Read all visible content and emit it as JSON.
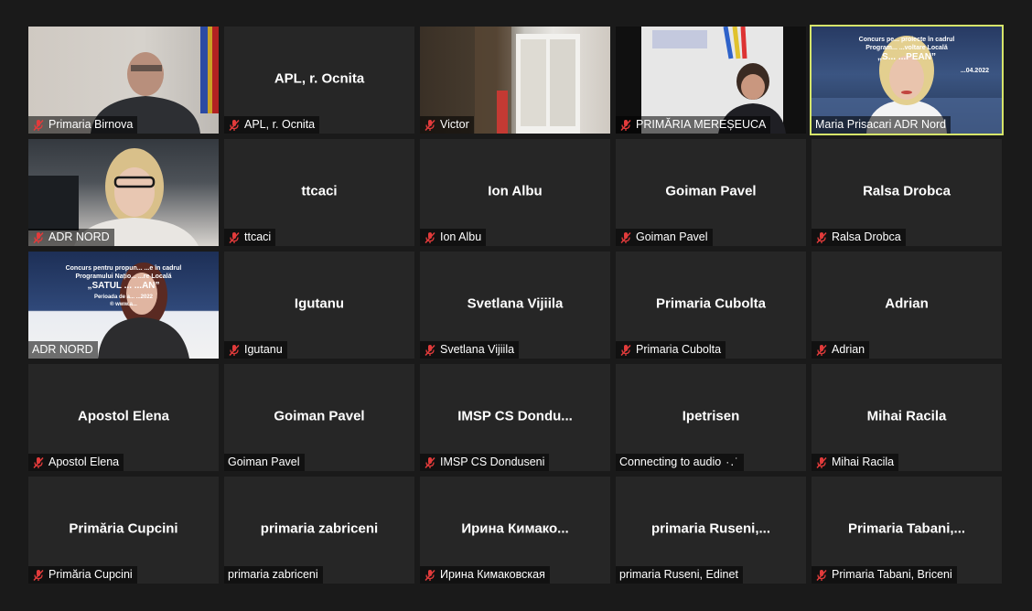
{
  "meeting": {
    "accent_color": "#d6e56a",
    "muted_icon": "mic-muted-icon",
    "tiles": [
      {
        "label": "Primaria Birnova",
        "display_name": "",
        "muted": true,
        "video": "v1"
      },
      {
        "label": "APL, r. Ocnita",
        "display_name": "APL, r. Ocnita",
        "muted": true,
        "video": ""
      },
      {
        "label": "Victor",
        "display_name": "",
        "muted": true,
        "video": "v2"
      },
      {
        "label": "PRIMĂRIA MEREȘEUCA",
        "display_name": "",
        "muted": true,
        "video": "v3"
      },
      {
        "label": "Maria Prisacari ADR Nord",
        "display_name": "",
        "muted": false,
        "video": "v4",
        "active": true
      },
      {
        "label": "ADR NORD",
        "display_name": "",
        "muted": true,
        "video": "v5"
      },
      {
        "label": "ttcaci",
        "display_name": "ttcaci",
        "muted": true,
        "video": ""
      },
      {
        "label": "Ion Albu",
        "display_name": "Ion Albu",
        "muted": true,
        "video": ""
      },
      {
        "label": "Goiman Pavel",
        "display_name": "Goiman Pavel",
        "muted": true,
        "video": ""
      },
      {
        "label": "Ralsa Drobca",
        "display_name": "Ralsa Drobca",
        "muted": true,
        "video": ""
      },
      {
        "label": "ADR NORD",
        "display_name": "",
        "muted": false,
        "video": "v6"
      },
      {
        "label": "Igutanu",
        "display_name": "Igutanu",
        "muted": true,
        "video": ""
      },
      {
        "label": "Svetlana Vijiila",
        "display_name": "Svetlana Vijiila",
        "muted": true,
        "video": ""
      },
      {
        "label": "Primaria Cubolta",
        "display_name": "Primaria Cubolta",
        "muted": true,
        "video": ""
      },
      {
        "label": "Adrian",
        "display_name": "Adrian",
        "muted": true,
        "video": ""
      },
      {
        "label": "Apostol Elena",
        "display_name": "Apostol Elena",
        "muted": true,
        "video": ""
      },
      {
        "label": "Goiman Pavel",
        "display_name": "Goiman Pavel",
        "muted": false,
        "video": ""
      },
      {
        "label": "IMSP CS Donduseni",
        "display_name": "IMSP  CS  Dondu...",
        "muted": true,
        "video": ""
      },
      {
        "label": "Connecting to audio",
        "display_name": "Ipetrisen",
        "muted": false,
        "connecting": true,
        "video": ""
      },
      {
        "label": "Mihai Racila",
        "display_name": "Mihai Racila",
        "muted": true,
        "video": ""
      },
      {
        "label": "Primăria Cupcini",
        "display_name": "Primăria Cupcini",
        "muted": true,
        "video": ""
      },
      {
        "label": "primaria zabriceni",
        "display_name": "primaria zabriceni",
        "muted": false,
        "video": ""
      },
      {
        "label": "Ирина Кимаковская",
        "display_name": "Ирина  Кимако...",
        "muted": true,
        "video": ""
      },
      {
        "label": "primaria Ruseni, Edinet",
        "display_name": "primaria  Ruseni,...",
        "muted": false,
        "video": ""
      },
      {
        "label": "Primaria Tabani, Briceni",
        "display_name": "Primaria  Tabani,...",
        "muted": true,
        "video": ""
      }
    ]
  },
  "posters": {
    "top": {
      "line1": "Concurs pe... proiecte în cadrul",
      "line2": "Program... ...voltare Locală",
      "line3": "„S... ...PEAN”",
      "line4": "...04.2022"
    },
    "bottom": {
      "line1": "Concurs pentru propun... ...e în cadrul",
      "line2": "Programului Națio... ...re Locală",
      "line3": "„SATUL ... ...AN”",
      "line4": "Perioada de a... ...2022",
      "line5": "® www.a..."
    }
  }
}
